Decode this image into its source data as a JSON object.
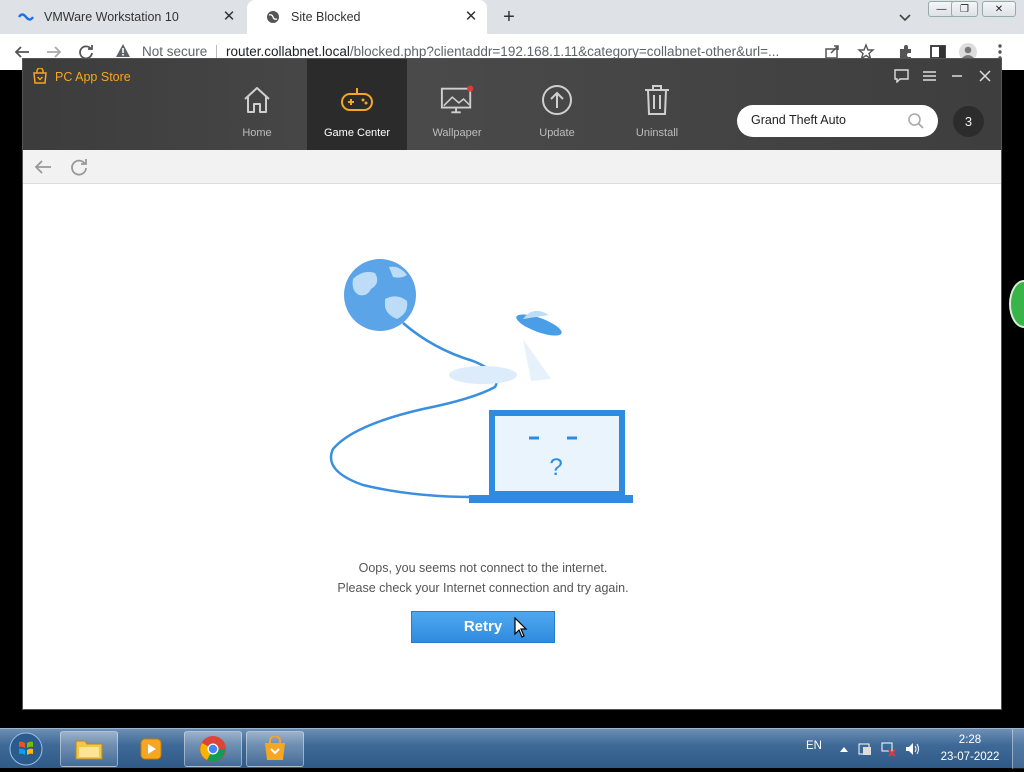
{
  "browser": {
    "tabs": [
      {
        "title": "VMWare Workstation 10",
        "icon": "vmware-icon"
      },
      {
        "title": "Site Blocked",
        "icon": "globe-icon"
      }
    ],
    "omnibox": {
      "security_label": "Not secure",
      "url_host": "router.collabnet.local",
      "url_rest": "/blocked.php?clientaddr=192.168.1.11&category=collabnet-other&url=..."
    }
  },
  "app": {
    "title": "PC App Store",
    "nav": [
      {
        "label": "Home",
        "icon": "home-icon"
      },
      {
        "label": "Game Center",
        "icon": "gamepad-icon"
      },
      {
        "label": "Wallpaper",
        "icon": "wallpaper-icon"
      },
      {
        "label": "Update",
        "icon": "update-icon"
      },
      {
        "label": "Uninstall",
        "icon": "trash-icon"
      }
    ],
    "search": {
      "value": "Grand Theft Auto"
    },
    "badge_count": "3",
    "error": {
      "line1": "Oops, you seems not connect to the internet.",
      "line2": "Please check your Internet connection and try again.",
      "question_mark": "?"
    },
    "retry_label": "Retry",
    "accent_color": "#f5a623"
  },
  "taskbar": {
    "language": "EN",
    "time": "2:28",
    "date": "23-07-2022"
  }
}
